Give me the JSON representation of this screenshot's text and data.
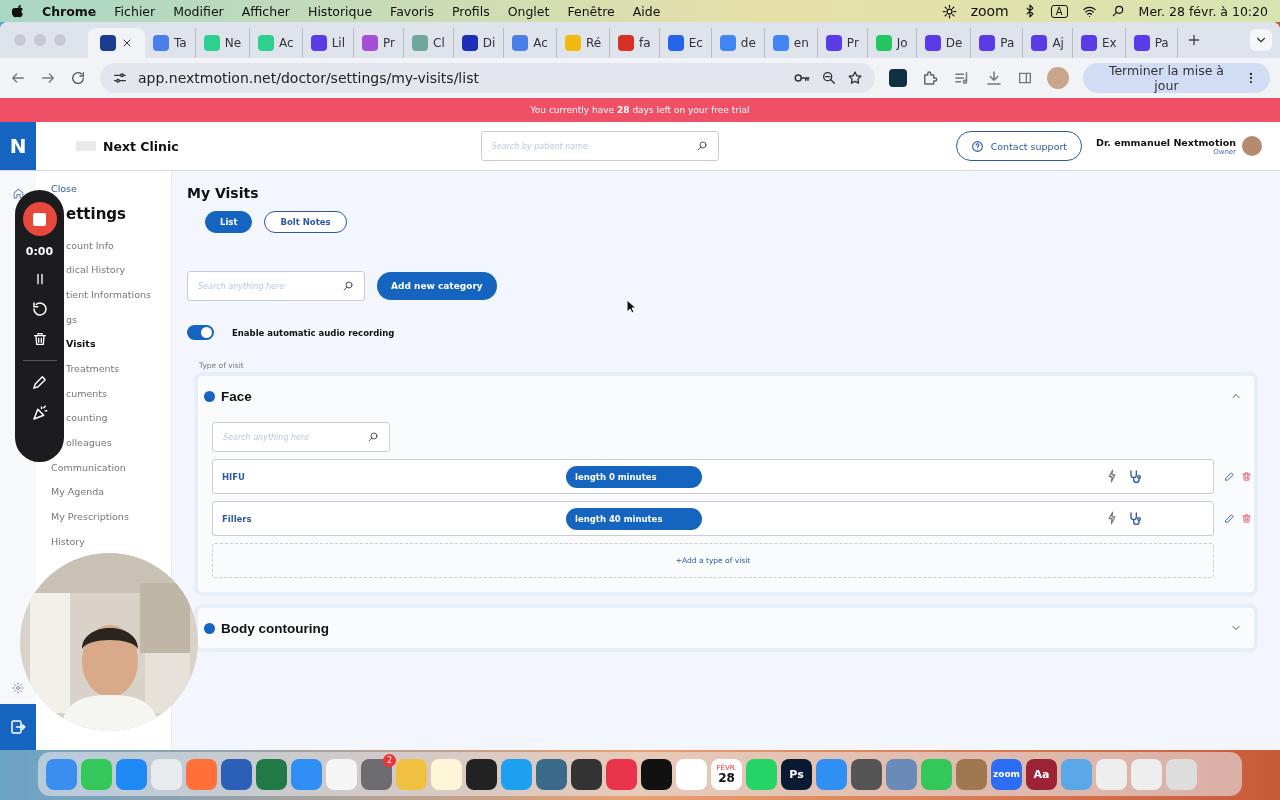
{
  "menu_bar": {
    "app": "Chrome",
    "items": [
      "Fichier",
      "Modifier",
      "Afficher",
      "Historique",
      "Favoris",
      "Profils",
      "Onglet",
      "Fenêtre",
      "Aide"
    ],
    "zoom_label": "zoom",
    "input_source": "A",
    "clock": "Mer. 28 févr. à 10:20"
  },
  "browser_tabs": [
    {
      "selected": true,
      "color": "#1b3d8f"
    },
    {
      "title": "Ta",
      "selected": false,
      "color": "#4a7ee8"
    },
    {
      "title": "Ne",
      "selected": false,
      "color": "#2ecf8f"
    },
    {
      "title": "Ac",
      "selected": false,
      "color": "#2ecf8f"
    },
    {
      "title": "Lil",
      "selected": false,
      "color": "#5b3be8"
    },
    {
      "title": "Pr",
      "selected": false,
      "color": "#a64fd6"
    },
    {
      "title": "Cl",
      "selected": false,
      "color": "#6fa89a"
    },
    {
      "title": "Di",
      "selected": false,
      "color": "#1d2fb8"
    },
    {
      "title": "Ac",
      "selected": false,
      "color": "#4a7ee8"
    },
    {
      "title": "Ré",
      "selected": false,
      "color": "#f2b90f"
    },
    {
      "title": "fa",
      "selected": false,
      "color": "#d93025"
    },
    {
      "title": "Ec",
      "selected": false,
      "color": "#2563eb"
    },
    {
      "title": "de",
      "selected": false,
      "color": "#4285f4"
    },
    {
      "title": "en",
      "selected": false,
      "color": "#4285f4"
    },
    {
      "title": "Pr",
      "selected": false,
      "color": "#5b3be8"
    },
    {
      "title": "Jo",
      "selected": false,
      "color": "#22c55e"
    },
    {
      "title": "De",
      "selected": false,
      "color": "#5b3be8"
    },
    {
      "title": "Pa",
      "selected": false,
      "color": "#5b3be8"
    },
    {
      "title": "Aj",
      "selected": false,
      "color": "#5b3be8"
    },
    {
      "title": "Ex",
      "selected": false,
      "color": "#5b3be8"
    },
    {
      "title": "Pa",
      "selected": false,
      "color": "#5b3be8"
    }
  ],
  "toolbar": {
    "url": "app.nextmotion.net/doctor/settings/my-visits/list",
    "update_button": "Terminer la mise à jour"
  },
  "banner": "You currently have **28** days left on your free trial",
  "header": {
    "logo": "N",
    "clinic": "Next Clinic",
    "search": {
      "placeholder": "Search by patient name"
    },
    "support_button": "Contact support",
    "user_name": "Dr. emmanuel Nextmotion",
    "user_role": "Owner"
  },
  "recorder": {
    "timer": "0:00"
  },
  "settings": {
    "close": "Close",
    "title": "ettings",
    "items": [
      {
        "label": "count Info",
        "kind": "cut",
        "selected": false
      },
      {
        "label": "dical History",
        "kind": "cut",
        "selected": false
      },
      {
        "label": "tient Informations",
        "kind": "cut",
        "selected": false
      },
      {
        "label": "gs",
        "kind": "cut",
        "selected": false
      },
      {
        "label": "Visits",
        "kind": "cut",
        "selected": true
      },
      {
        "label": "Treatments",
        "kind": "cut",
        "selected": false
      },
      {
        "label": "cuments",
        "kind": "cut",
        "selected": false
      },
      {
        "label": "counting",
        "kind": "cut",
        "selected": false
      },
      {
        "label": "olleagues",
        "kind": "cut",
        "selected": false
      },
      {
        "label": "Communication",
        "kind": "full",
        "selected": false
      },
      {
        "label": "My Agenda",
        "kind": "full",
        "selected": false
      },
      {
        "label": "My Prescriptions",
        "kind": "full",
        "selected": false
      },
      {
        "label": "History",
        "kind": "full",
        "selected": false
      }
    ]
  },
  "main": {
    "title": "My Visits",
    "view_tabs": [
      {
        "label": "List",
        "selected": true
      },
      {
        "label": "Bolt Notes",
        "selected": false
      }
    ],
    "search": {
      "placeholder": "Search anything here"
    },
    "add_button": "Add new category",
    "audio_toggle": {
      "label": "Enable automatic audio recording",
      "on": true
    },
    "section_label": "Type of visit",
    "categories": [
      {
        "name": "Face",
        "expanded": true,
        "search": {
          "placeholder": "Search anything here"
        },
        "visits": [
          {
            "name": "HIFU",
            "length": "length 0 minutes"
          },
          {
            "name": "Fillers",
            "length": "length 40 minutes"
          }
        ],
        "add_link": "+Add a type of visit"
      },
      {
        "name": "Body contouring",
        "expanded": false
      }
    ]
  },
  "dock": [
    {
      "color": "#3b8ef0"
    },
    {
      "color": "#34c759"
    },
    {
      "color": "#1e88f5"
    },
    {
      "color": "#e8eaed"
    },
    {
      "color": "#ff7139"
    },
    {
      "color": "#2b5fb8"
    },
    {
      "color": "#1f7a45"
    },
    {
      "color": "#2f8ff5"
    },
    {
      "color": "#f5f5f5"
    },
    {
      "color": "#6b6b70",
      "badge": "2"
    },
    {
      "color": "#f0c040"
    },
    {
      "color": "#fdf6d8"
    },
    {
      "color": "#222222"
    },
    {
      "color": "#1ea0f0"
    },
    {
      "color": "#3a6a8a"
    },
    {
      "color": "#333333"
    },
    {
      "color": "#e8334a"
    },
    {
      "color": "#111111"
    },
    {
      "color": "#ffffff"
    },
    {
      "color": "#ffffff",
      "month": "FÉVR.",
      "label": "28"
    },
    {
      "color": "#25d366"
    },
    {
      "color": "#0a1a33",
      "label": "Ps"
    },
    {
      "color": "#2f8ff5"
    },
    {
      "color": "#555555"
    },
    {
      "color": "#6a8ab8"
    },
    {
      "color": "#34c759"
    },
    {
      "color": "#a07850"
    },
    {
      "color": "#2d6cf5",
      "label": "zoom"
    },
    {
      "color": "#9b2335",
      "label": "Aa"
    },
    {
      "color": "#5aa8e8"
    },
    {
      "color": "#eeeeee"
    },
    {
      "color": "#eeeeee"
    },
    {
      "color": "#dddddd"
    }
  ]
}
